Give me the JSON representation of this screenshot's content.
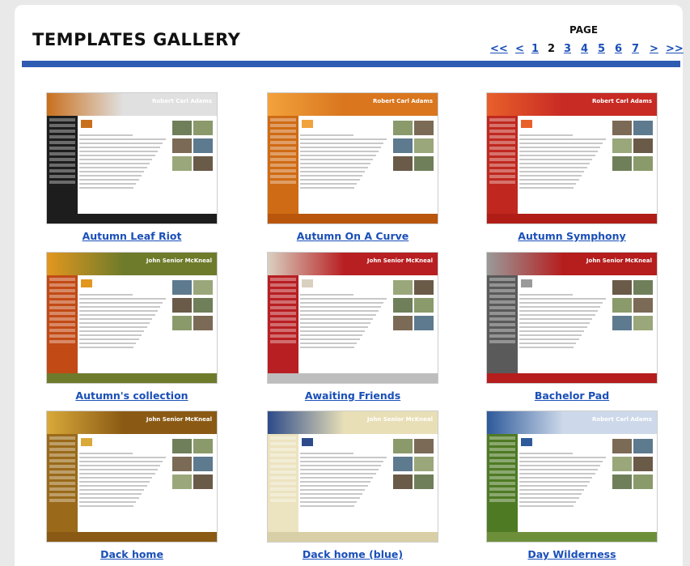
{
  "header": {
    "title": "TEMPLATES GALLERY"
  },
  "pagination": {
    "label": "PAGE",
    "first": "<<",
    "prev": "<",
    "pages": [
      "1",
      "2",
      "3",
      "4",
      "5",
      "6",
      "7"
    ],
    "current": "2",
    "next": ">",
    "last": ">>"
  },
  "templates": [
    {
      "name": "Autumn Leaf Riot",
      "site_name": "Robert Carl Adams",
      "banner": "#e0e0e0",
      "side": "#1d1d1d",
      "foot": "#1d1d1d",
      "accent": "#c9701d"
    },
    {
      "name": "Autumn On A Curve",
      "site_name": "Robert Carl Adams",
      "banner": "#d9761e",
      "side": "#cf6b14",
      "foot": "#b9560c",
      "accent": "#f2a23c"
    },
    {
      "name": "Autumn Symphony",
      "site_name": "Robert Carl Adams",
      "banner": "#c82a24",
      "side": "#c0281f",
      "foot": "#b01d17",
      "accent": "#e8602a"
    },
    {
      "name": "Autumn's collection",
      "site_name": "John Senior McKneal",
      "banner": "#6e7b2a",
      "side": "#c24a15",
      "foot": "#6e7b2a",
      "accent": "#e2971f"
    },
    {
      "name": "Awaiting Friends",
      "site_name": "John Senior McKneal",
      "banner": "#b81f22",
      "side": "#b81f22",
      "foot": "#bdbdbd",
      "accent": "#d9d0c0"
    },
    {
      "name": "Bachelor Pad",
      "site_name": "John Senior McKneal",
      "banner": "#b61d1d",
      "side": "#5a5a5a",
      "foot": "#b61d1d",
      "accent": "#9a9a9a"
    },
    {
      "name": "Dack home",
      "site_name": "John Senior McKneal",
      "banner": "#8a5a14",
      "side": "#9a6a1a",
      "foot": "#8a5a14",
      "accent": "#d9a93a"
    },
    {
      "name": "Dack home (blue)",
      "site_name": "John Senior McKneal",
      "banner": "#e8dfb7",
      "side": "#ece3c0",
      "foot": "#d8cfa6",
      "accent": "#2d4b8a"
    },
    {
      "name": "Day Wilderness",
      "site_name": "Robert Carl Adams",
      "banner": "#cdd9ea",
      "side": "#4e7a24",
      "foot": "#6d8f3a",
      "accent": "#2e5a9a"
    }
  ]
}
